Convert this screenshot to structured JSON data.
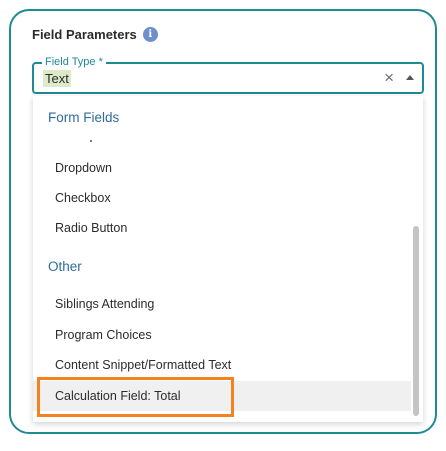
{
  "card": {
    "title": "Field Parameters",
    "info_glyph": "i"
  },
  "field_type": {
    "label": "Field Type *",
    "value": "Text",
    "clear_glyph": "×"
  },
  "dropdown": {
    "groups": [
      {
        "label": "Form Fields",
        "options": [
          "Dropdown",
          "Checkbox",
          "Radio Button"
        ]
      },
      {
        "label": "Other",
        "options": [
          "Siblings Attending",
          "Program Choices",
          "Content Snippet/Formatted Text",
          "Calculation Field: Total"
        ]
      }
    ],
    "highlighted_option": "Calculation Field: Total"
  },
  "colors": {
    "accent": "#1e8a94",
    "group_label": "#2e6c9a",
    "highlight_border": "#f58220",
    "value_highlight": "#dde9c9"
  },
  "icons": [
    "info-icon",
    "clear-icon",
    "chevron-up-icon"
  ]
}
